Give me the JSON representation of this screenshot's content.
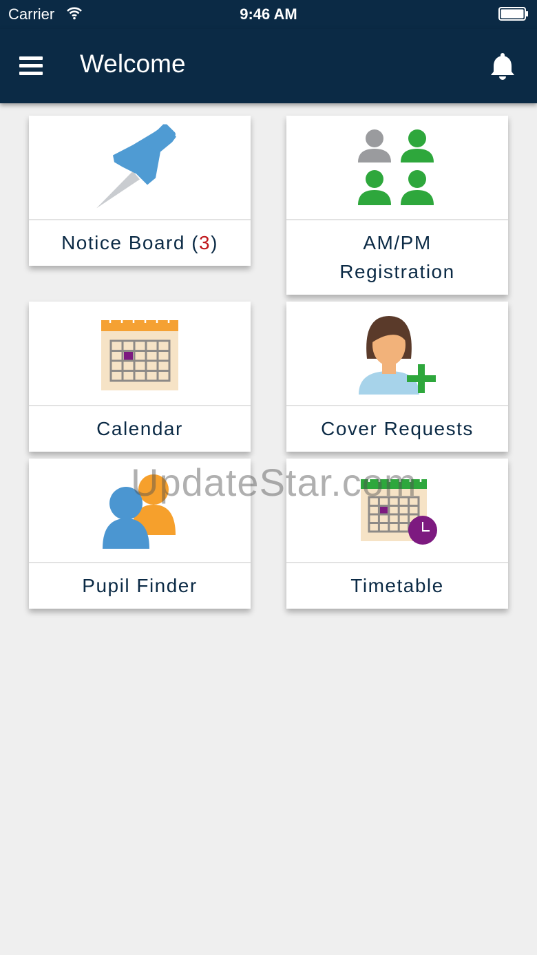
{
  "status_bar": {
    "carrier": "Carrier",
    "time": "9:46 AM"
  },
  "app_bar": {
    "title": "Welcome"
  },
  "tiles": [
    {
      "label": "Notice Board (",
      "badge": "3",
      "suffix": ")",
      "icon": "pushpin-icon"
    },
    {
      "label_line1": "AM/PM",
      "label_line2": "Registration",
      "icon": "people-group-icon"
    },
    {
      "label": "Calendar",
      "icon": "calendar-icon"
    },
    {
      "label": "Cover Requests",
      "icon": "person-add-icon"
    },
    {
      "label": "Pupil Finder",
      "icon": "pupils-icon"
    },
    {
      "label": "Timetable",
      "icon": "timetable-icon"
    }
  ],
  "watermark": "UpdateStar.com",
  "colors": {
    "header": "#0b2a45",
    "background": "#efefef",
    "badge": "#c0171c"
  }
}
